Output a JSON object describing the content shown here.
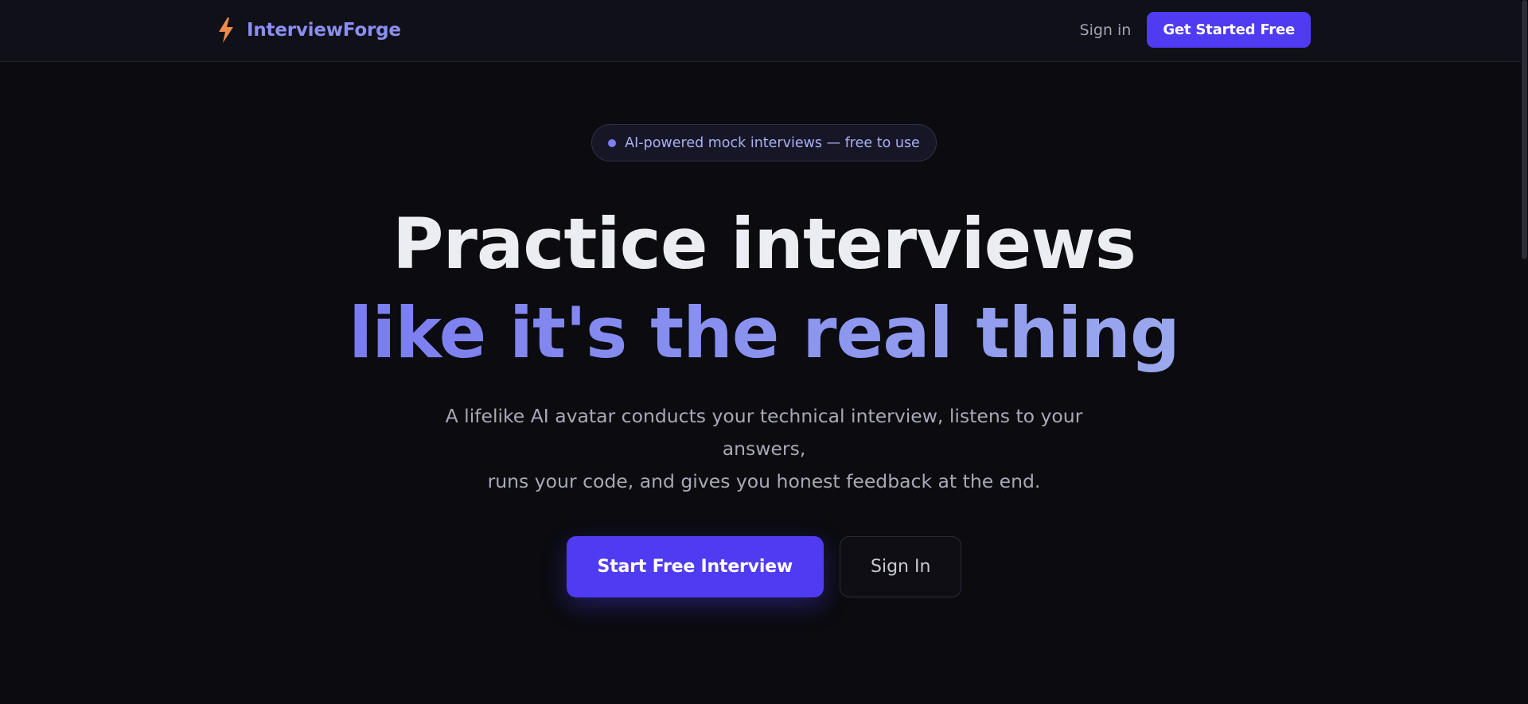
{
  "colors": {
    "background": "#0b0b10",
    "header_background": "#101019",
    "accent": "#4f3cf2",
    "brand_text": "#8b8ff2",
    "headline_accent": "#8a93ef",
    "bolt_icon": "#f08a4b"
  },
  "header": {
    "brand": {
      "icon": "lightning-bolt-icon",
      "name": "InterviewForge"
    },
    "sign_in_label": "Sign in",
    "cta_label": "Get Started Free"
  },
  "hero": {
    "badge": {
      "icon": "dot-icon",
      "text": "AI-powered mock interviews — free to use"
    },
    "headline_line1": "Practice interviews",
    "headline_line2": "like it's the real thing",
    "subtitle_line1": "A lifelike AI avatar conducts your technical interview, listens to your answers,",
    "subtitle_line2": "runs your code, and gives you honest feedback at the end.",
    "primary_button": "Start Free Interview",
    "secondary_button": "Sign In"
  }
}
